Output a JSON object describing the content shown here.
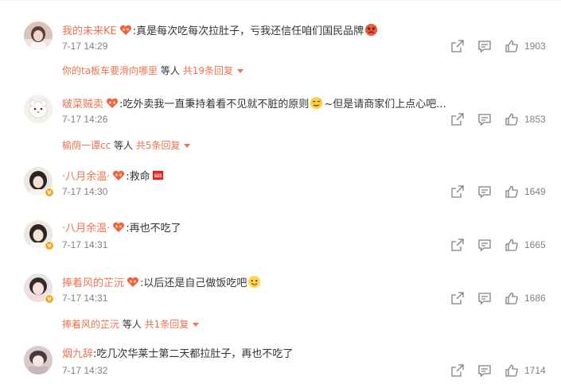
{
  "comments": [
    {
      "username": "我的未来KE",
      "text": ":真是每次吃每次拉肚子，亏我还信任咱们国民品牌",
      "time": "7-17 14:29",
      "likes": "1903",
      "replies": {
        "name": "你的ta板车要滑向哪里",
        "mid": " 等人 ",
        "total": "共19条回复"
      }
    },
    {
      "username": "啵菜贼卖",
      "text": ":吃外卖我一直秉持着看不见就不脏的原则",
      "text_after": "~但是请商家们上点心吧...",
      "time": "7-17 14:26",
      "likes": "1853",
      "replies": {
        "name": "榆荫一谭cc",
        "mid": " 等人 ",
        "total": "共5条回复"
      }
    },
    {
      "username": "·八月余温·",
      "text": ":救命",
      "time": "7-17 14:30",
      "likes": "1649"
    },
    {
      "username": "·八月余温·",
      "text": ":再也不吃了",
      "time": "7-17 14:31",
      "likes": "1665"
    },
    {
      "username": "捧着风的芷沅",
      "text": ":以后还是自己做饭吃吧",
      "time": "7-17 14:31",
      "likes": "1686",
      "replies": {
        "name": "捧着风的芷沅",
        "mid": " 等人 ",
        "total": "共1条回复"
      }
    },
    {
      "username": "烟九辞",
      "text": ":吃几次华莱士第二天都拉肚子，再也不吃了",
      "time": "7-17 14:32",
      "likes": "1714"
    }
  ],
  "icons": {
    "share": "share-icon",
    "comment": "comment-icon",
    "like": "thumbs-up-icon",
    "badge": "fan-badge-icon",
    "verified": "verified-v-icon"
  },
  "colors": {
    "accent": "#eb7350",
    "text": "#333333",
    "muted": "#808080"
  }
}
